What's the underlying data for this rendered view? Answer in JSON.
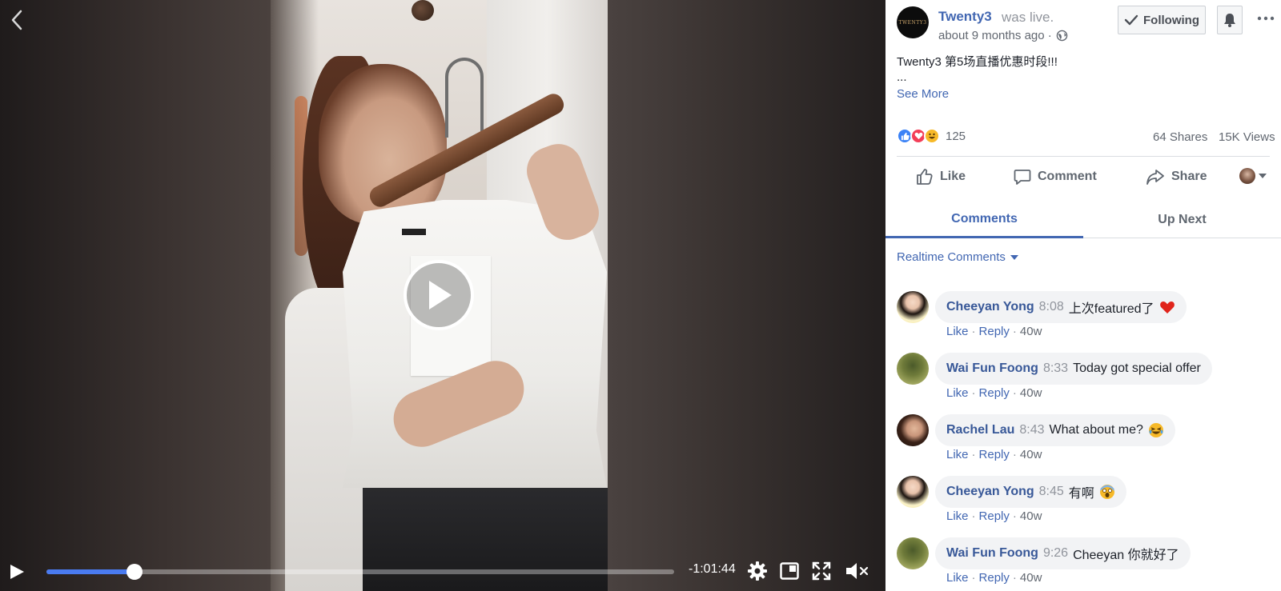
{
  "video": {
    "time_remaining": "-1:01:44",
    "progress_fraction": 0.14,
    "colors": {
      "progress": "#4a7bf0",
      "control": "#ffffff"
    },
    "icons": [
      "back-chevron-icon",
      "play-icon",
      "settings-gear-icon",
      "pip-icon",
      "fullscreen-icon",
      "volume-muted-icon"
    ]
  },
  "post": {
    "page_name": "Twenty3",
    "avatar_text": "TWENTY3",
    "status_text": "was live.",
    "time_text": "about 9 months ago ·",
    "following_label": "Following",
    "body_text": "Twenty3 第5场直播优惠时段!!!",
    "ellipsis": "...",
    "see_more": "See More",
    "reaction_count": "125",
    "shares": "64 Shares",
    "views": "15K Views",
    "actions": {
      "like": "Like",
      "comment": "Comment",
      "share": "Share"
    },
    "colors": {
      "link": "#4267b2",
      "like_reaction": "#3b82f6",
      "love_reaction": "#f33e58",
      "haha_reaction": "#f7b928"
    }
  },
  "tabs": [
    {
      "label": "Comments",
      "active": true
    },
    {
      "label": "Up Next",
      "active": false
    }
  ],
  "comment_filter": "Realtime Comments",
  "comments": [
    {
      "author": "Cheeyan Yong",
      "time": "8:08",
      "text": "上次featured了",
      "emoji": "heart",
      "like": "Like",
      "reply": "Reply",
      "age": "40w"
    },
    {
      "author": "Wai Fun Foong",
      "time": "8:33",
      "text": "Today got special offer",
      "emoji": "",
      "like": "Like",
      "reply": "Reply",
      "age": "40w"
    },
    {
      "author": "Rachel Lau",
      "time": "8:43",
      "text": "What about me?",
      "emoji": "laugh",
      "like": "Like",
      "reply": "Reply",
      "age": "40w"
    },
    {
      "author": "Cheeyan Yong",
      "time": "8:45",
      "text": "有啊",
      "emoji": "scream",
      "like": "Like",
      "reply": "Reply",
      "age": "40w"
    },
    {
      "author": "Wai Fun Foong",
      "time": "9:26",
      "text": "Cheeyan 你就好了",
      "emoji": "",
      "like": "Like",
      "reply": "Reply",
      "age": "40w"
    }
  ]
}
